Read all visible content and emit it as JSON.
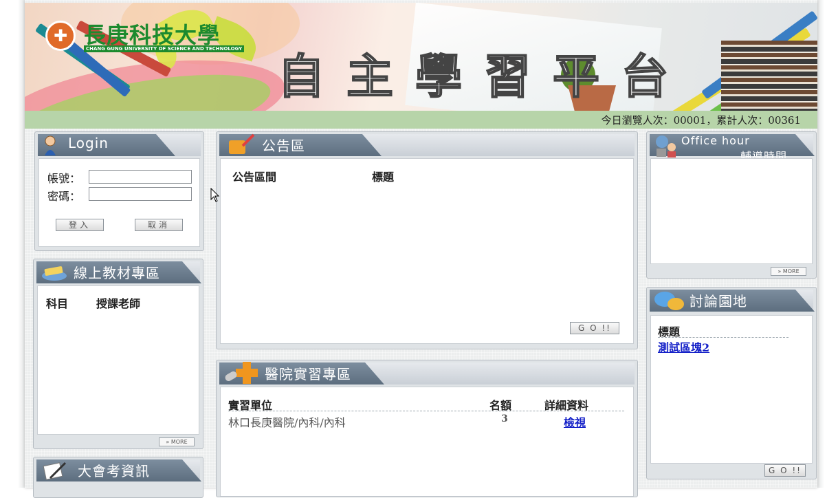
{
  "banner": {
    "logo_zh": "長庚科技大學",
    "logo_en": "CHANG GUNG UNIVERSITY OF SCIENCE AND TECHNOLOGY",
    "site_title": "自主學習平台"
  },
  "visitor": {
    "text": "今日瀏覽人次：00001，累計人次：00361"
  },
  "login": {
    "title": "Login",
    "account_label": "帳號：",
    "password_label": "密碼：",
    "account_value": "",
    "password_value": "",
    "login_button": "登入",
    "cancel_button": "取消"
  },
  "materials": {
    "title": "線上教材專區",
    "col_subject": "科目",
    "col_teacher": "授課老師",
    "more": "» MORE"
  },
  "exam": {
    "title": "大會考資訊"
  },
  "announce": {
    "title": "公告區",
    "col_period": "公告區間",
    "col_title": "標題",
    "go_button": "G O !!"
  },
  "hospital": {
    "title": "醫院實習專區",
    "col_unit": "實習單位",
    "col_quota": "名額",
    "col_detail": "詳細資料",
    "rows": [
      {
        "unit": "林口長庚醫院/內科/內科",
        "quota": "3",
        "detail": "檢視"
      }
    ]
  },
  "office": {
    "title_en": "Office hour",
    "title_zh": "輔導時間",
    "more": "» MORE"
  },
  "forum": {
    "title": "討論園地",
    "col_title": "標題",
    "items": [
      "測試區塊2"
    ],
    "go_button": "G O !!"
  },
  "colors": {
    "header_blue": "#6d7e8f",
    "visit_bar": "#b7d4a9",
    "link": "#1420c8",
    "logo_green": "#1c8a2e"
  }
}
